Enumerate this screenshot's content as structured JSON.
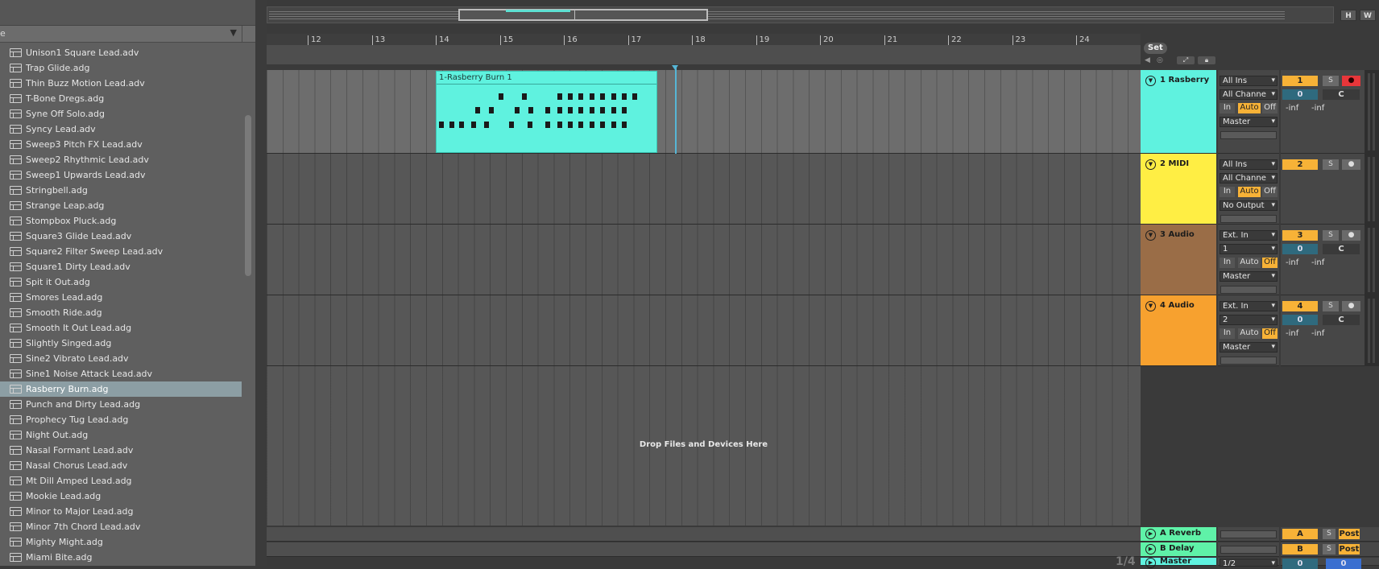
{
  "browser": {
    "header_text": "e",
    "items": [
      "Unison1 Square Lead.adv",
      "Trap Glide.adg",
      "Thin Buzz Motion Lead.adv",
      "T-Bone Dregs.adg",
      "Syne Off Solo.adg",
      "Syncy Lead.adv",
      "Sweep3 Pitch FX Lead.adv",
      "Sweep2 Rhythmic Lead.adv",
      "Sweep1 Upwards Lead.adv",
      "Stringbell.adg",
      "Strange Leap.adg",
      "Stompbox Pluck.adg",
      "Square3 Glide Lead.adv",
      "Square2 Filter Sweep Lead.adv",
      "Square1 Dirty Lead.adv",
      "Spit it Out.adg",
      "Smores Lead.adg",
      "Smooth Ride.adg",
      "Smooth It Out Lead.adg",
      "Slightly Singed.adg",
      "Sine2 Vibrato Lead.adv",
      "Sine1 Noise Attack Lead.adv",
      "Rasberry Burn.adg",
      "Punch and Dirty Lead.adg",
      "Prophecy Tug Lead.adg",
      "Night Out.adg",
      "Nasal Formant Lead.adv",
      "Nasal Chorus Lead.adv",
      "Mt Dill Amped Lead.adg",
      "Mookie Lead.adg",
      "Minor to Major Lead.adg",
      "Minor 7th Chord Lead.adv",
      "Mighty Might.adg",
      "Miami Bite.adg"
    ],
    "selected": "Rasberry Burn.adg"
  },
  "toolbar": {
    "h_label": "H",
    "w_label": "W"
  },
  "ruler": {
    "bars": [
      "12",
      "13",
      "14",
      "15",
      "16",
      "17",
      "18",
      "19",
      "20",
      "21",
      "22",
      "23",
      "24"
    ]
  },
  "set_label": "Set",
  "clip": {
    "title": "1-Rasberry Burn 1"
  },
  "drop_text": "Drop Files and Devices Here",
  "tracks": [
    {
      "name": "1 Rasberry",
      "color": "#5ff2df",
      "input_type": "All Ins",
      "input_channel": "All Channe",
      "monitor": [
        "In",
        "Auto",
        "Off"
      ],
      "monitor_active": "Auto",
      "output": "Master",
      "number": "1",
      "solo": "S",
      "volume": "0",
      "pan": "C",
      "meter_l": "-inf",
      "meter_r": "-inf",
      "armed": true
    },
    {
      "name": "2 MIDI",
      "color": "#ffee44",
      "input_type": "All Ins",
      "input_channel": "All Channe",
      "monitor": [
        "In",
        "Auto",
        "Off"
      ],
      "monitor_active": "Auto",
      "output": "No Output",
      "number": "2",
      "solo": "S",
      "armed": false
    },
    {
      "name": "3 Audio",
      "color": "#9a6d47",
      "input_type": "Ext. In",
      "input_channel": "1",
      "monitor": [
        "In",
        "Auto",
        "Off"
      ],
      "monitor_active": "Off",
      "output": "Master",
      "number": "3",
      "solo": "S",
      "volume": "0",
      "pan": "C",
      "meter_l": "-inf",
      "meter_r": "-inf",
      "armed": false
    },
    {
      "name": "4 Audio",
      "color": "#f7a12f",
      "input_type": "Ext. In",
      "input_channel": "2",
      "monitor": [
        "In",
        "Auto",
        "Off"
      ],
      "monitor_active": "Off",
      "output": "Master",
      "number": "4",
      "solo": "S",
      "volume": "0",
      "pan": "C",
      "meter_l": "-inf",
      "meter_r": "-inf",
      "armed": false
    }
  ],
  "returns": [
    {
      "name": "A Reverb",
      "letter": "A",
      "solo": "S",
      "post": "Post"
    },
    {
      "name": "B Delay",
      "letter": "B",
      "solo": "S",
      "post": "Post"
    }
  ],
  "master": {
    "name": "Master",
    "io": "1/2",
    "vol_l": "0",
    "vol_r": "0"
  },
  "page_indicator": "1/4"
}
